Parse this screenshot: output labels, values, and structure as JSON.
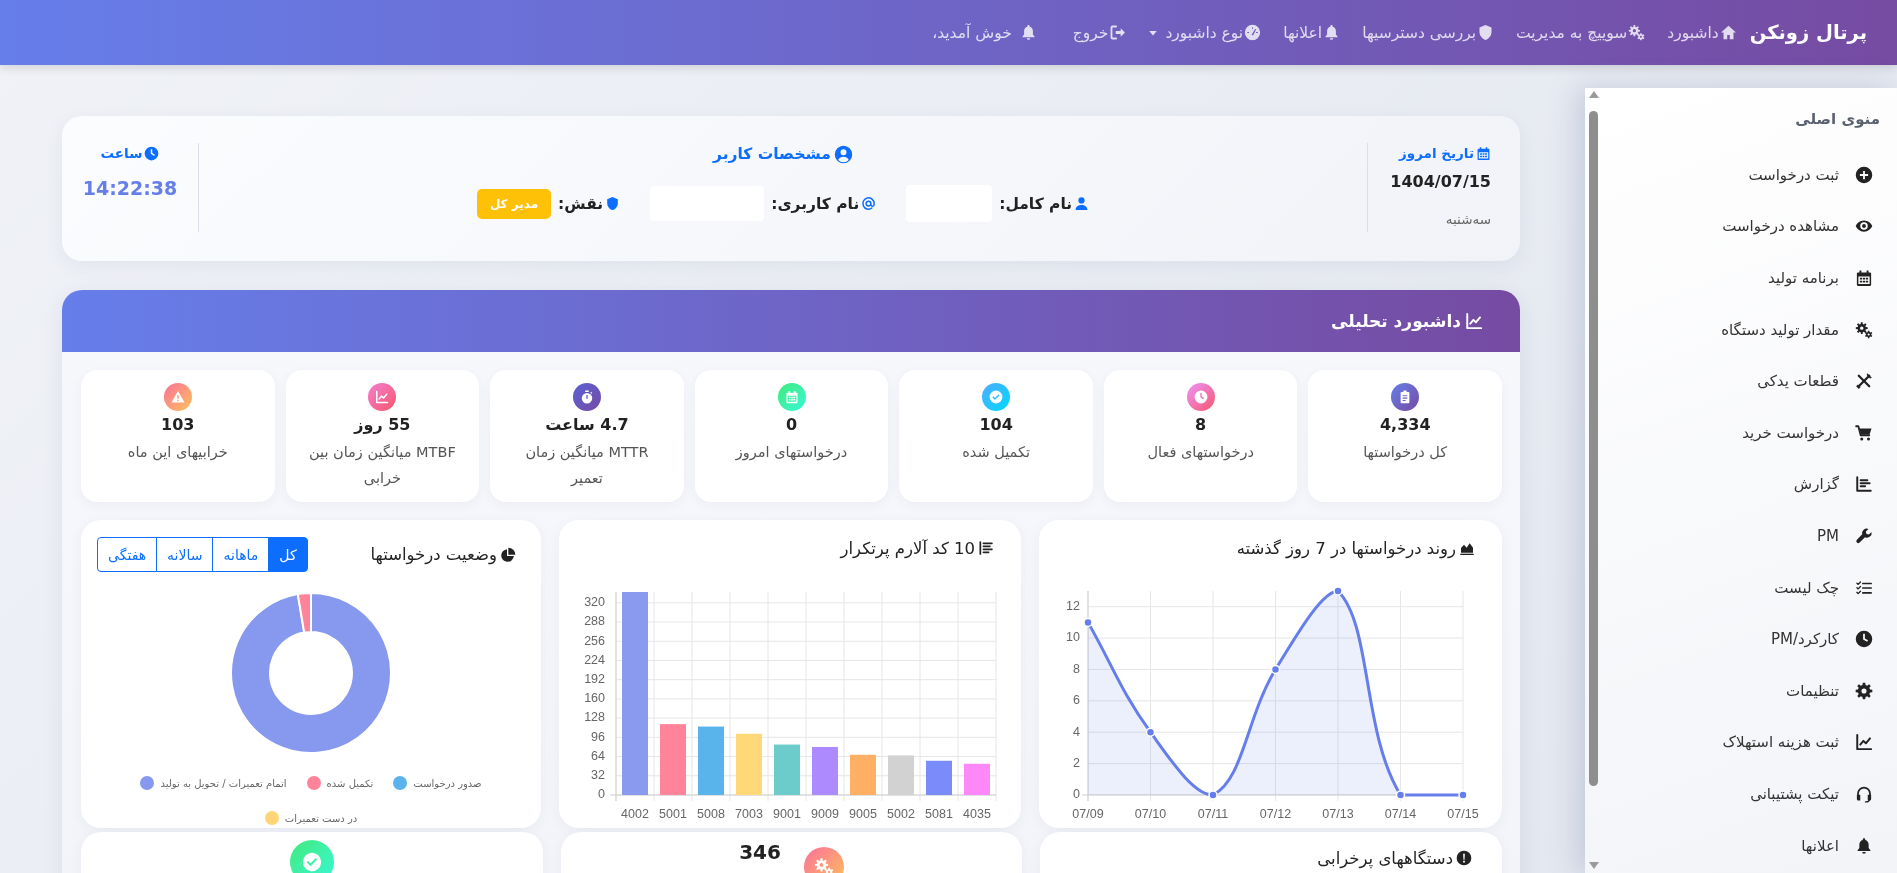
{
  "navbar": {
    "brand": "پرتال زونکن",
    "items": [
      {
        "label": "داشبورد",
        "dropdown": false
      },
      {
        "label": "سوییچ به مدیریت",
        "dropdown": false
      },
      {
        "label": "بررسی دسترسیها",
        "dropdown": false
      },
      {
        "label": "اعلانها",
        "dropdown": false
      },
      {
        "label": "نوع داشبورد",
        "dropdown": true
      },
      {
        "label": "خروج",
        "dropdown": false
      }
    ],
    "welcome": "خوش آمدید،"
  },
  "sidebar": {
    "title": "منوی اصلی",
    "items": [
      {
        "label": "ثبت درخواست"
      },
      {
        "label": "مشاهده درخواست"
      },
      {
        "label": "برنامه تولید"
      },
      {
        "label": "مقدار تولید دستگاه"
      },
      {
        "label": "قطعات یدکی"
      },
      {
        "label": "درخواست خرید"
      },
      {
        "label": "گزارش"
      },
      {
        "label": "PM"
      },
      {
        "label": "چک لیست"
      },
      {
        "label": "کارکرد/PM"
      },
      {
        "label": "تنظیمات"
      },
      {
        "label": "ثبت هزینه استهلاک"
      },
      {
        "label": "تیکت پشتیبانی"
      },
      {
        "label": "اعلانها"
      }
    ]
  },
  "user_card": {
    "date_title": "تاریخ امروز",
    "date": "1404/07/15",
    "weekday": "سه‌شنبه",
    "profile_title": "مشخصات کاربر",
    "fields": [
      {
        "kind": "empty",
        "label": "نام کامل:"
      },
      {
        "kind": "empty",
        "label": "نام کاربری:"
      },
      {
        "kind": "badge",
        "label": "نقش:",
        "badge": "مدیر کل"
      }
    ],
    "clock_title": "ساعت",
    "time": "14:22:38"
  },
  "analytics": {
    "title": "داشبورد تحلیلی",
    "stats": [
      {
        "value": "4,334",
        "label": "کل درخواستها"
      },
      {
        "value": "8",
        "label": "درخواستهای فعال"
      },
      {
        "value": "104",
        "label": "تکمیل شده"
      },
      {
        "value": "0",
        "label": "درخواستهای امروز"
      },
      {
        "value": "4.7 ساعت",
        "label": "MTTR میانگین زمان تعمیر"
      },
      {
        "value": "55 روز",
        "label": "MTBF میانگین زمان بین خرابی"
      },
      {
        "value": "103",
        "label": "خرابیهای این ماه"
      }
    ],
    "trend_chart": {
      "chart_data": {
        "type": "area",
        "title": "روند درخواستها در 7 روز گذشته",
        "categories": [
          "07/09",
          "07/10",
          "07/11",
          "07/12",
          "07/13",
          "07/14",
          "07/15"
        ],
        "series": [
          {
            "color": "#667eea",
            "marker": "circle",
            "values": [
              11,
              4,
              0,
              8,
              13,
              0,
              0
            ]
          }
        ],
        "ylim": [
          0,
          13
        ],
        "yticks": [
          0,
          2,
          4,
          6,
          8,
          10,
          12
        ],
        "grid": true
      }
    },
    "alarm_chart": {
      "chart_data": {
        "type": "bar",
        "title": "10 کد آلارم پرتکرار",
        "categories": [
          "4002",
          "5001",
          "5008",
          "7003",
          "9001",
          "9009",
          "9005",
          "5002",
          "5081",
          "4035"
        ],
        "values": [
          338,
          118,
          114,
          102,
          84,
          80,
          67,
          66,
          57,
          52
        ],
        "ylim": [
          0,
          338
        ],
        "yticks": [
          0,
          32,
          64,
          96,
          128,
          160,
          192,
          224,
          256,
          288,
          320
        ],
        "grid": true
      }
    },
    "status_chart": {
      "title": "وضعیت درخواستها",
      "filters": [
        {
          "label": "کل",
          "selected": true
        },
        {
          "label": "ماهانه",
          "selected": false
        },
        {
          "label": "سالانه",
          "selected": false
        },
        {
          "label": "هفتگی",
          "selected": false
        }
      ],
      "legend": [
        {
          "label": "صدور درخواست",
          "color": "#5ab3ec"
        },
        {
          "label": "تکمیل شده",
          "color": "#ff8399"
        },
        {
          "label": "اتمام تعمیرات / تحویل به تولید",
          "color": "#8799ee"
        },
        {
          "label": "در دست تعمیرات",
          "color": "#ffd677"
        }
      ]
    },
    "bottom_cards": [
      {
        "kind": "titled",
        "title": "دستگاههای پرخرابی"
      },
      {
        "kind": "stat",
        "value": "346"
      },
      {
        "kind": "icon_only"
      }
    ]
  }
}
